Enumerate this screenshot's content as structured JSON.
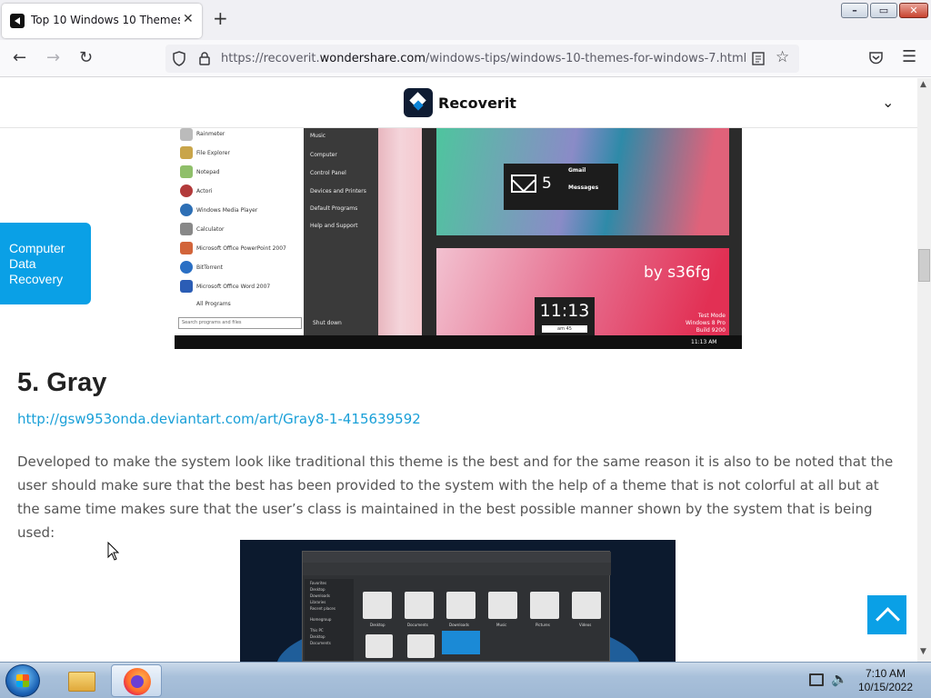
{
  "browser": {
    "tab_title": "Top 10 Windows 10 Themes for",
    "tab_close": "✕",
    "new_tab": "+",
    "window_controls": {
      "minimize": "–",
      "maximize": "▭",
      "close": "✕"
    },
    "url_prefix": "https://recoverit.",
    "url_host": "wondershare.com",
    "url_path": "/windows-tips/windows-10-themes-for-windows-7.html",
    "icons": {
      "back": "arrow-left-icon",
      "forward": "arrow-right-icon",
      "reload": "reload-icon",
      "shield": "shield-icon",
      "lock": "lock-icon",
      "reader": "reader-view-icon",
      "bookmark": "star-icon",
      "pocket": "pocket-icon",
      "menu": "hamburger-menu-icon"
    }
  },
  "site": {
    "brand": "Recoverit",
    "side_tab": "Computer Data Recovery"
  },
  "screenshot1": {
    "start_items": [
      "Rainmeter",
      "File Explorer",
      "Notepad",
      "Actori",
      "Windows Media Player",
      "Calculator",
      "Microsoft Office PowerPoint 2007",
      "BitTorrent",
      "Microsoft Office Word 2007",
      "All Programs"
    ],
    "right_items": [
      "Music",
      "Computer",
      "Control Panel",
      "Devices and Printers",
      "Default Programs",
      "Help and Support"
    ],
    "search_placeholder": "Search programs and files",
    "shutdown": "Shut down",
    "mail_count": "5",
    "mail_gmail": "Gmail",
    "mail_messages": "Messages",
    "signature": "by s36fg",
    "clock": "11:13",
    "clock_sub": "am      45",
    "test_mode": "Test Mode\nWindows 8 Pro\nBuild 9200",
    "taskbar_time": "11:13 AM"
  },
  "article": {
    "heading": "5. Gray",
    "link": "http://gsw953onda.deviantart.com/art/Gray8-1-415639592",
    "paragraph": "Developed to make the system look like traditional this theme is the best and for the same reason it is also to be noted that the user should make sure that the best has been provided to the system with the help of a theme that is not colorful at all but at the same time makes sure that the user’s class is maintained in the best possible manner shown by the system that is being used:"
  },
  "screenshot2": {
    "nav_items": [
      "Favorites",
      "Desktop",
      "Downloads",
      "Libraries",
      "Recent places",
      "Homegroup",
      "This PC",
      "Desktop",
      "Documents"
    ],
    "folders": [
      "Desktop",
      "Documents",
      "Downloads",
      "Music",
      "Pictures",
      "Videos"
    ]
  },
  "taskbar": {
    "time": "7:10 AM",
    "date": "10/15/2022"
  }
}
